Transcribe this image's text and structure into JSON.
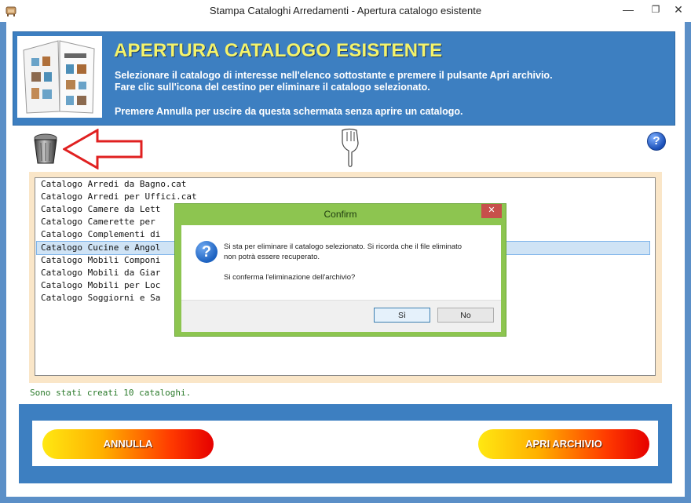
{
  "window": {
    "title": "Stampa Cataloghi Arredamenti - Apertura catalogo esistente",
    "minimize_glyph": "—",
    "maximize_glyph": "❐",
    "close_glyph": "✕"
  },
  "header": {
    "title": "APERTURA CATALOGO ESISTENTE",
    "line1": "Selezionare il catalogo di interesse nell'elenco sottostante e premere il pulsante Apri archivio.",
    "line2": "Fare clic sull'icona del cestino per eliminare il catalogo selezionato.",
    "line3": "Premere Annulla per uscire da questa schermata senza aprire un catalogo.",
    "image_icon": "catalog-book-icon"
  },
  "toolbar": {
    "trash_icon": "trash-bin-icon",
    "arrow_icon": "red-arrow-icon",
    "hand_icon": "pointing-hand-icon",
    "help_glyph": "?"
  },
  "catalog_list": {
    "items": [
      "Catalogo Arredi da Bagno.cat",
      "Catalogo Arredi per Uffici.cat",
      "Catalogo Camere da Lett",
      "Catalogo Camerette per",
      "Catalogo Complementi di",
      "Catalogo Cucine e Angol",
      "Catalogo Mobili Componi",
      "Catalogo Mobili da Giar",
      "Catalogo Mobili per Loc",
      "Catalogo Soggiorni e Sa"
    ],
    "selected_index": 5
  },
  "status": {
    "text": "Sono stati creati 10 cataloghi."
  },
  "buttons": {
    "cancel": "ANNULLA",
    "open": "APRI ARCHIVIO"
  },
  "dialog": {
    "title": "Confirm",
    "close_glyph": "✕",
    "icon_glyph": "?",
    "message_line1": "Si sta per eliminare il catalogo selezionato. Si ricorda che il file eliminato",
    "message_line2": "non potrà essere recuperato.",
    "message_line3": "Si conferma l'eliminazione dell'archivio?",
    "yes_label": "Sì",
    "no_label": "No"
  },
  "colors": {
    "frame_blue": "#3d7fc1",
    "title_yellow": "#f4f36b",
    "dialog_green": "#8dc550",
    "status_green": "#2a7a2a"
  }
}
